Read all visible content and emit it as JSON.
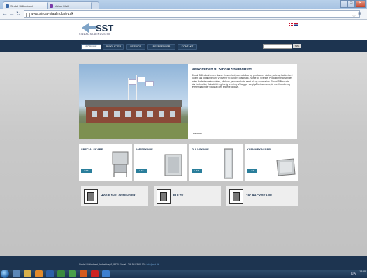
{
  "browser": {
    "tabs": [
      {
        "label": "Sindal Stålindustri"
      },
      {
        "label": "Yahoo Mail"
      }
    ],
    "back_icon": "back-arrow-icon",
    "forward_icon": "forward-arrow-icon",
    "reload_icon": "reload-icon",
    "url": "www.sindal-staalindustry.dk",
    "window_controls": {
      "minimize": "–",
      "maximize": "□",
      "close": "✕"
    }
  },
  "site": {
    "logo_text": "SST",
    "logo_tagline": "SINDAL STÅLINDUSTRI",
    "menu": [
      "FORSIDE",
      "PRODUKTER",
      "SERVICE",
      "REFERENCER",
      "KONTAKT"
    ],
    "search_button": "SØG",
    "hero": {
      "title": "Velkommen til Sindal Stålindustri",
      "body": "Sindal Stålindustri er en dansk virksomhed, som udvikler og producerer skabe, pulte og kabinetter i rustfrit stål og aluminium. Vi leverer til kunder i Danmark, Norge og Sverige. Produkterne anvendes inden for fødevareindustrien, offshore, procesindustri samt el- og automation. Sindal Stålindustri står for kvalitet, fleksibilitet og hurtig levering. Vi lægger vægt på tæt samarbejde med kunden og leverer løsninger tilpasset den enkelte opgave.",
      "more": "Læs mere"
    },
    "categories": [
      {
        "title": "SPECIALSKABE",
        "button": "LÆS MERE"
      },
      {
        "title": "VÆGSKABE",
        "button": "LÆS MERE"
      },
      {
        "title": "GULVSKABE",
        "button": "LÆS MERE"
      },
      {
        "title": "KLEMMEKASSER",
        "button": "LÆS MERE"
      }
    ],
    "secondary": [
      {
        "title": "HYGIEJNELØSNINGER"
      },
      {
        "title": "PULTE"
      },
      {
        "title": "19\" RACKSKABE"
      }
    ],
    "footer_text": "Sindal Stålindustri, Industrivej 6, 9870 Sindal · Tlf. 98 93 60 00 · ",
    "footer_link": "info@sst.dk"
  },
  "taskbar": {
    "apps": [
      "explorer",
      "folder",
      "media",
      "word",
      "excel",
      "chrome",
      "firefox",
      "opera",
      "ie"
    ],
    "tray_text": "DA",
    "time": "12:00"
  },
  "colors": {
    "navy": "#1d3450",
    "teal": "#2a7e9b",
    "page_bg": "#c6c6c6"
  }
}
